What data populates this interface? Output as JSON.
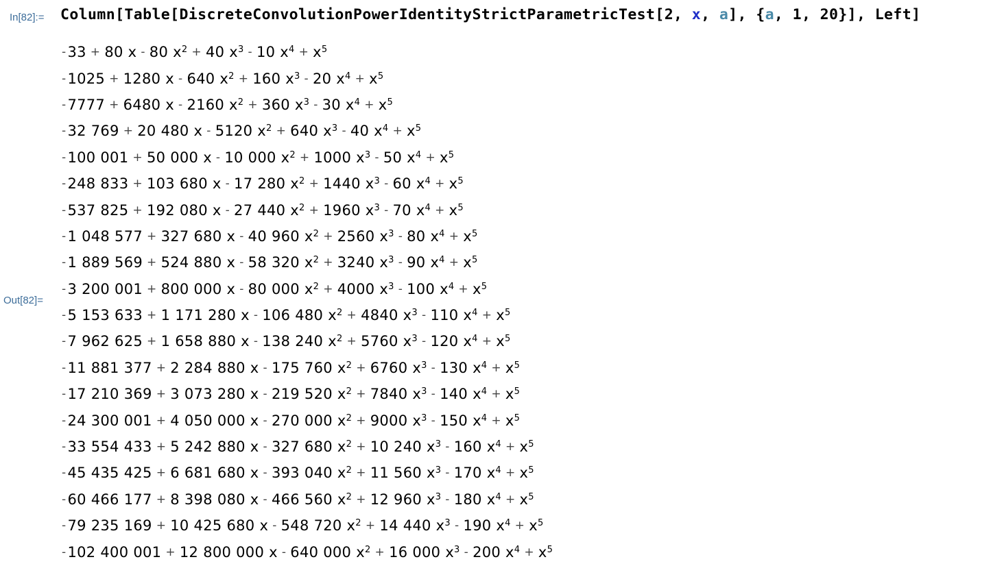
{
  "cell": {
    "in_label": "In[82]:=",
    "out_label": "Out[82]=",
    "input": {
      "part1": "Column[Table[DiscreteConvolutionPowerIdentityStrictParametricTest[2, ",
      "x": "x",
      "part2": ", ",
      "a1": "a",
      "part3": "], {",
      "a2": "a",
      "part4": ", 1, 20}], Left]"
    }
  },
  "output_rows": [
    [
      "-33",
      "80 x",
      "80 x^2",
      "40 x^3",
      "10 x^4",
      "x^5"
    ],
    [
      "-1025",
      "1280 x",
      "640 x^2",
      "160 x^3",
      "20 x^4",
      "x^5"
    ],
    [
      "-7777",
      "6480 x",
      "2160 x^2",
      "360 x^3",
      "30 x^4",
      "x^5"
    ],
    [
      "-32 769",
      "20 480 x",
      "5120 x^2",
      "640 x^3",
      "40 x^4",
      "x^5"
    ],
    [
      "-100 001",
      "50 000 x",
      "10 000 x^2",
      "1000 x^3",
      "50 x^4",
      "x^5"
    ],
    [
      "-248 833",
      "103 680 x",
      "17 280 x^2",
      "1440 x^3",
      "60 x^4",
      "x^5"
    ],
    [
      "-537 825",
      "192 080 x",
      "27 440 x^2",
      "1960 x^3",
      "70 x^4",
      "x^5"
    ],
    [
      "-1 048 577",
      "327 680 x",
      "40 960 x^2",
      "2560 x^3",
      "80 x^4",
      "x^5"
    ],
    [
      "-1 889 569",
      "524 880 x",
      "58 320 x^2",
      "3240 x^3",
      "90 x^4",
      "x^5"
    ],
    [
      "-3 200 001",
      "800 000 x",
      "80 000 x^2",
      "4000 x^3",
      "100 x^4",
      "x^5"
    ],
    [
      "-5 153 633",
      "1 171 280 x",
      "106 480 x^2",
      "4840 x^3",
      "110 x^4",
      "x^5"
    ],
    [
      "-7 962 625",
      "1 658 880 x",
      "138 240 x^2",
      "5760 x^3",
      "120 x^4",
      "x^5"
    ],
    [
      "-11 881 377",
      "2 284 880 x",
      "175 760 x^2",
      "6760 x^3",
      "130 x^4",
      "x^5"
    ],
    [
      "-17 210 369",
      "3 073 280 x",
      "219 520 x^2",
      "7840 x^3",
      "140 x^4",
      "x^5"
    ],
    [
      "-24 300 001",
      "4 050 000 x",
      "270 000 x^2",
      "9000 x^3",
      "150 x^4",
      "x^5"
    ],
    [
      "-33 554 433",
      "5 242 880 x",
      "327 680 x^2",
      "10 240 x^3",
      "160 x^4",
      "x^5"
    ],
    [
      "-45 435 425",
      "6 681 680 x",
      "393 040 x^2",
      "11 560 x^3",
      "170 x^4",
      "x^5"
    ],
    [
      "-60 466 177",
      "8 398 080 x",
      "466 560 x^2",
      "12 960 x^3",
      "180 x^4",
      "x^5"
    ],
    [
      "-79 235 169",
      "10 425 680 x",
      "548 720 x^2",
      "14 440 x^3",
      "190 x^4",
      "x^5"
    ],
    [
      "-102 400 001",
      "12 800 000 x",
      "640 000 x^2",
      "16 000 x^3",
      "200 x^4",
      "x^5"
    ]
  ],
  "sign_pattern": [
    "-",
    "+",
    "-",
    "+",
    "-",
    "+"
  ]
}
